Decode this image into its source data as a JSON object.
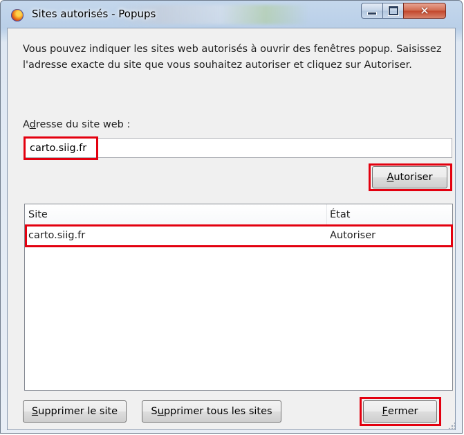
{
  "window": {
    "title": "Sites autorisés - Popups",
    "minimize_symbol": "",
    "maximize_symbol": "",
    "close_symbol": "✕"
  },
  "intro_text": "Vous pouvez indiquer les sites web autorisés à ouvrir des fenêtres popup. Saisissez l'adresse exacte du site que vous souhaitez autoriser et cliquez sur Autoriser.",
  "address": {
    "label_prefix": "A",
    "label_underlined": "d",
    "label_rest": "resse du site web :",
    "value": "carto.siig.fr"
  },
  "allow_button": {
    "underlined": "A",
    "rest": "utoriser"
  },
  "list": {
    "headers": {
      "site": "Site",
      "state": "État"
    },
    "rows": [
      {
        "site": "carto.siig.fr",
        "state": "Autoriser"
      }
    ]
  },
  "buttons": {
    "remove_site": {
      "underlined": "S",
      "rest": "upprimer le site"
    },
    "remove_all": {
      "prefix": "S",
      "underlined": "u",
      "rest": "pprimer tous les sites"
    },
    "close": {
      "underlined": "F",
      "rest": "ermer"
    }
  },
  "highlight_color": "#e3000f",
  "icons": {
    "app": "firefox-icon",
    "minimize": "minimize-icon",
    "maximize": "maximize-icon",
    "close": "close-icon"
  }
}
